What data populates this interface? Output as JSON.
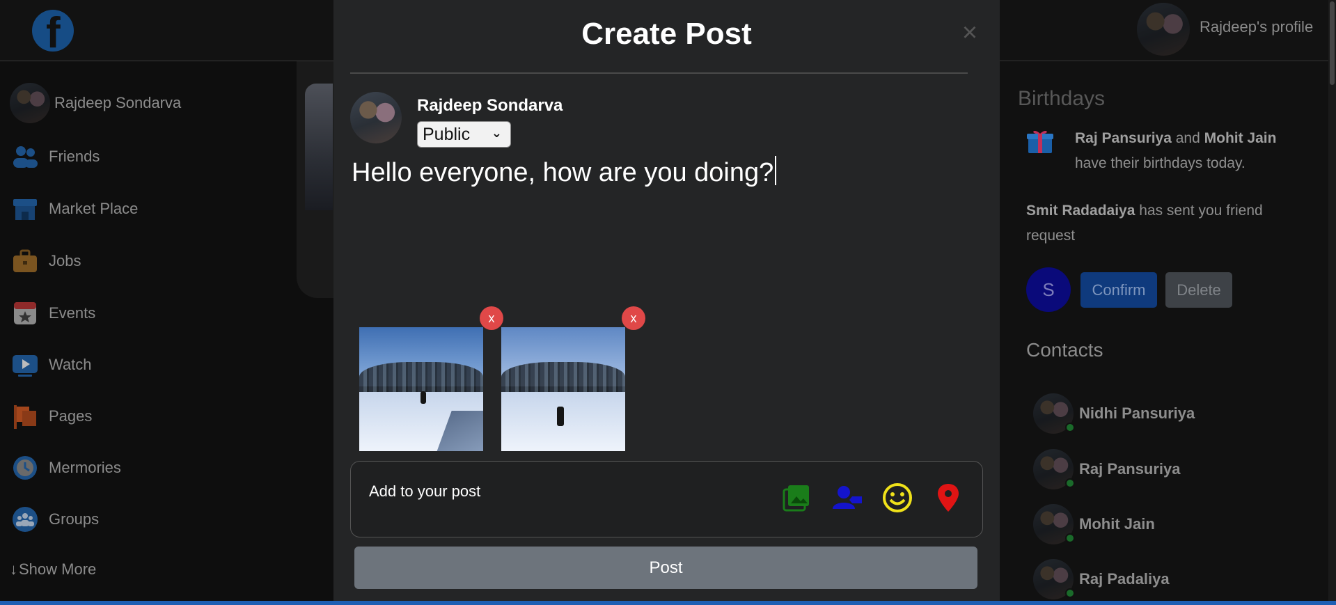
{
  "header": {
    "logo": "f",
    "profile_label": "Rajdeep's profile"
  },
  "sidebar": {
    "user_name": "Rajdeep Sondarva",
    "items": [
      {
        "label": "Friends",
        "icon": "friends-icon"
      },
      {
        "label": "Market Place",
        "icon": "marketplace-icon"
      },
      {
        "label": "Jobs",
        "icon": "jobs-icon"
      },
      {
        "label": "Events",
        "icon": "events-icon"
      },
      {
        "label": "Watch",
        "icon": "watch-icon"
      },
      {
        "label": "Pages",
        "icon": "pages-icon"
      },
      {
        "label": "Mermories",
        "icon": "memories-icon"
      },
      {
        "label": "Groups",
        "icon": "groups-icon"
      }
    ],
    "show_more": "Show More"
  },
  "modal": {
    "title": "Create Post",
    "close": "×",
    "author_name": "Rajdeep Sondarva",
    "privacy": "Public",
    "post_text": "Hello everyone, how are you doing?",
    "remove_label": "x",
    "add_to_post": "Add to your post",
    "add_icons": [
      {
        "name": "photo-icon",
        "color": "#1a7d1a"
      },
      {
        "name": "tag-people-icon",
        "color": "#1414cc"
      },
      {
        "name": "feeling-icon",
        "color": "#f0e21a"
      },
      {
        "name": "location-icon",
        "color": "#e01414"
      }
    ],
    "post_button": "Post"
  },
  "rightbar": {
    "birthdays_title": "Birthdays",
    "birthday_name1": "Raj Pansuriya",
    "birthday_and": " and ",
    "birthday_name2": "Mohit Jain",
    "birthday_suffix": " have their birthdays today.",
    "request_name": "Smit Radadaiya",
    "request_suffix": " has sent you friend request",
    "request_initial": "S",
    "confirm": "Confirm",
    "delete": "Delete",
    "contacts_title": "Contacts",
    "contacts": [
      {
        "name": "Nidhi Pansuriya"
      },
      {
        "name": "Raj Pansuriya"
      },
      {
        "name": "Mohit Jain"
      },
      {
        "name": "Raj Padaliya"
      }
    ]
  }
}
